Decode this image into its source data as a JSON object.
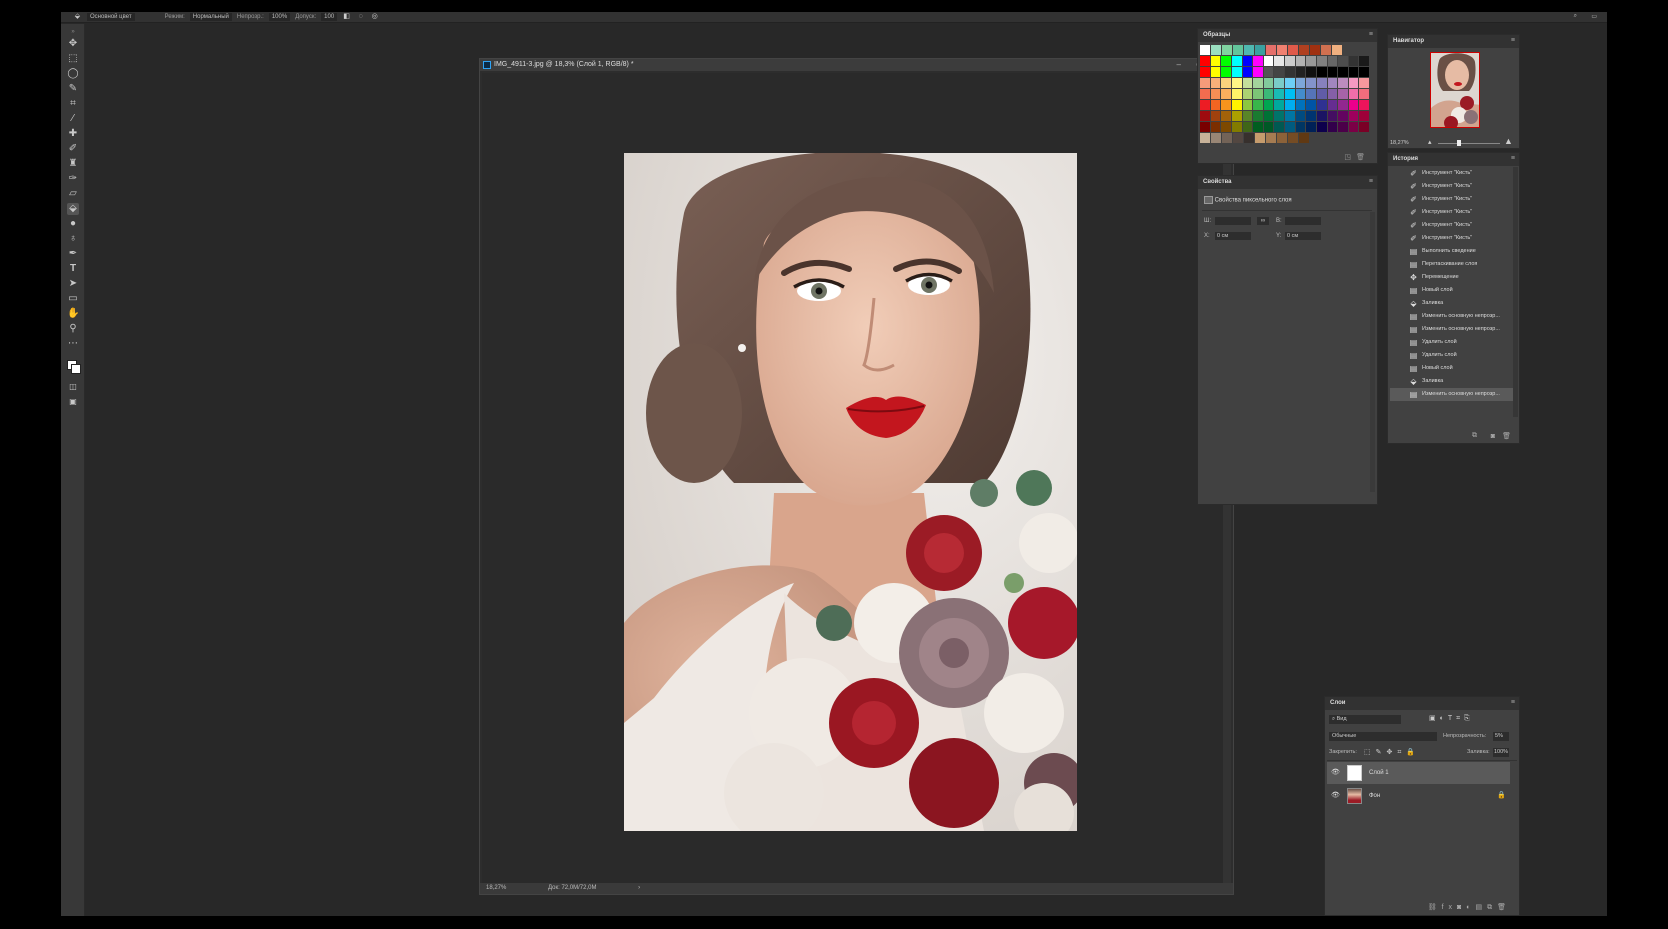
{
  "options_bar": {
    "tool_preset": "Основной цвет",
    "mode_label": "Режим:",
    "mode_value": "Нормальный",
    "opacity_label": "Непрозр.:",
    "opacity_value": "100%",
    "tolerance_label": "Допуск:",
    "tolerance_value": "100"
  },
  "document": {
    "title": "IMG_4911-3.jpg @ 18,3% (Слой 1, RGB/8) *",
    "status_zoom": "18,27%",
    "status_doc": "Док: 72,0M/72,0M"
  },
  "swatches": {
    "tab": "Образцы",
    "rows": [
      [
        "#ffffff",
        "#9be0c1",
        "#7fd3a0",
        "#62c59b",
        "#4fb8b0",
        "#3aa0a0",
        "#e56f6a",
        "#f08070",
        "#e05a4a",
        "#b04020",
        "#a03010",
        "#d07050",
        "#f0b080"
      ],
      [
        "#ff0000",
        "#ffff00",
        "#00ff00",
        "#00ffff",
        "#0000ff",
        "#ff00ff",
        "#ffffff",
        "#e6e6e6",
        "#cccccc",
        "#b3b3b3",
        "#999999",
        "#808080",
        "#666666",
        "#4d4d4d",
        "#333333",
        "#1a1a1a"
      ],
      [
        "#ff0000",
        "#ffff00",
        "#00ff00",
        "#00ffff",
        "#0000ff",
        "#ff00ff",
        "#555555",
        "#444444",
        "#333333",
        "#222222",
        "#111111",
        "#000000",
        "#000000",
        "#000000",
        "#000000",
        "#000000"
      ],
      [
        "#f59b7a",
        "#f7b07a",
        "#fbd37d",
        "#fff685",
        "#c4df9b",
        "#a3d39c",
        "#82ca9c",
        "#7accc8",
        "#6dcff6",
        "#7da7d9",
        "#8393ca",
        "#8781bd",
        "#a186be",
        "#bd8cbf",
        "#f49ac2",
        "#f6989d"
      ],
      [
        "#f26c4f",
        "#f68e55",
        "#fbaf5d",
        "#fff467",
        "#acd372",
        "#7cc576",
        "#3bb878",
        "#1abbb4",
        "#00bff3",
        "#438ccb",
        "#5574b9",
        "#605ca8",
        "#855fa8",
        "#a763a8",
        "#f06eaa",
        "#f26d7d"
      ],
      [
        "#ed1c24",
        "#f26522",
        "#f7941d",
        "#fff200",
        "#8dc73f",
        "#39b54a",
        "#00a651",
        "#00a99d",
        "#00aeef",
        "#0072bc",
        "#0054a6",
        "#2e3192",
        "#662d91",
        "#92278f",
        "#ec008c",
        "#ed145b"
      ],
      [
        "#9e0b0f",
        "#a0410d",
        "#a36209",
        "#aba000",
        "#598527",
        "#1a7b30",
        "#007236",
        "#00746b",
        "#0076a3",
        "#004b80",
        "#003471",
        "#1b1464",
        "#440e62",
        "#630460",
        "#9e005d",
        "#9e0039"
      ],
      [
        "#790000",
        "#7b2e00",
        "#7d4900",
        "#827b00",
        "#406618",
        "#005e20",
        "#005826",
        "#005952",
        "#005b7f",
        "#003663",
        "#002157",
        "#0d004c",
        "#32004b",
        "#4b0049",
        "#7b0046",
        "#7a0026"
      ],
      [
        "#c7b299",
        "#998675",
        "#736357",
        "#534741",
        "#37302d",
        "#c69c6d",
        "#a67c52",
        "#8c6239",
        "#754c24",
        "#603913"
      ]
    ]
  },
  "properties": {
    "tab": "Свойства",
    "subtitle": "Свойства пиксельного слоя",
    "w_label": "Ш:",
    "h_label": "В:",
    "x_label": "X:",
    "x_value": "0 см",
    "y_label": "Y:",
    "y_value": "0 см"
  },
  "navigator": {
    "tab": "Навигатор",
    "zoom": "18,27%"
  },
  "history": {
    "tab": "История",
    "items": [
      {
        "label": "Инструмент \"Кисть\"",
        "icon": "brush-icon"
      },
      {
        "label": "Инструмент \"Кисть\"",
        "icon": "brush-icon"
      },
      {
        "label": "Инструмент \"Кисть\"",
        "icon": "brush-icon"
      },
      {
        "label": "Инструмент \"Кисть\"",
        "icon": "brush-icon"
      },
      {
        "label": "Инструмент \"Кисть\"",
        "icon": "brush-icon"
      },
      {
        "label": "Инструмент \"Кисть\"",
        "icon": "brush-icon"
      },
      {
        "label": "Выполнить сведение",
        "icon": "doc-icon"
      },
      {
        "label": "Перетаскивание слоя",
        "icon": "doc-icon"
      },
      {
        "label": "Перемещение",
        "icon": "move-icon"
      },
      {
        "label": "Новый слой",
        "icon": "doc-icon"
      },
      {
        "label": "Заливка",
        "icon": "bucket-icon"
      },
      {
        "label": "Изменить основную непрозр...",
        "icon": "doc-icon"
      },
      {
        "label": "Изменить основную непрозр...",
        "icon": "doc-icon"
      },
      {
        "label": "Удалить слой",
        "icon": "doc-icon"
      },
      {
        "label": "Удалить слой",
        "icon": "doc-icon"
      },
      {
        "label": "Новый слой",
        "icon": "doc-icon"
      },
      {
        "label": "Заливка",
        "icon": "bucket-icon"
      },
      {
        "label": "Изменить основную непрозр...",
        "icon": "doc-icon"
      }
    ]
  },
  "layers": {
    "tab": "Слои",
    "filter": "Вид",
    "blend_mode": "Обычные",
    "opacity_label": "Непрозрачность:",
    "opacity_value": "5%",
    "lock_label": "Закрепить:",
    "fill_label": "Заливка:",
    "fill_value": "100%",
    "items": [
      {
        "name": "Слой 1",
        "selected": true
      },
      {
        "name": "Фон",
        "selected": false
      }
    ]
  }
}
